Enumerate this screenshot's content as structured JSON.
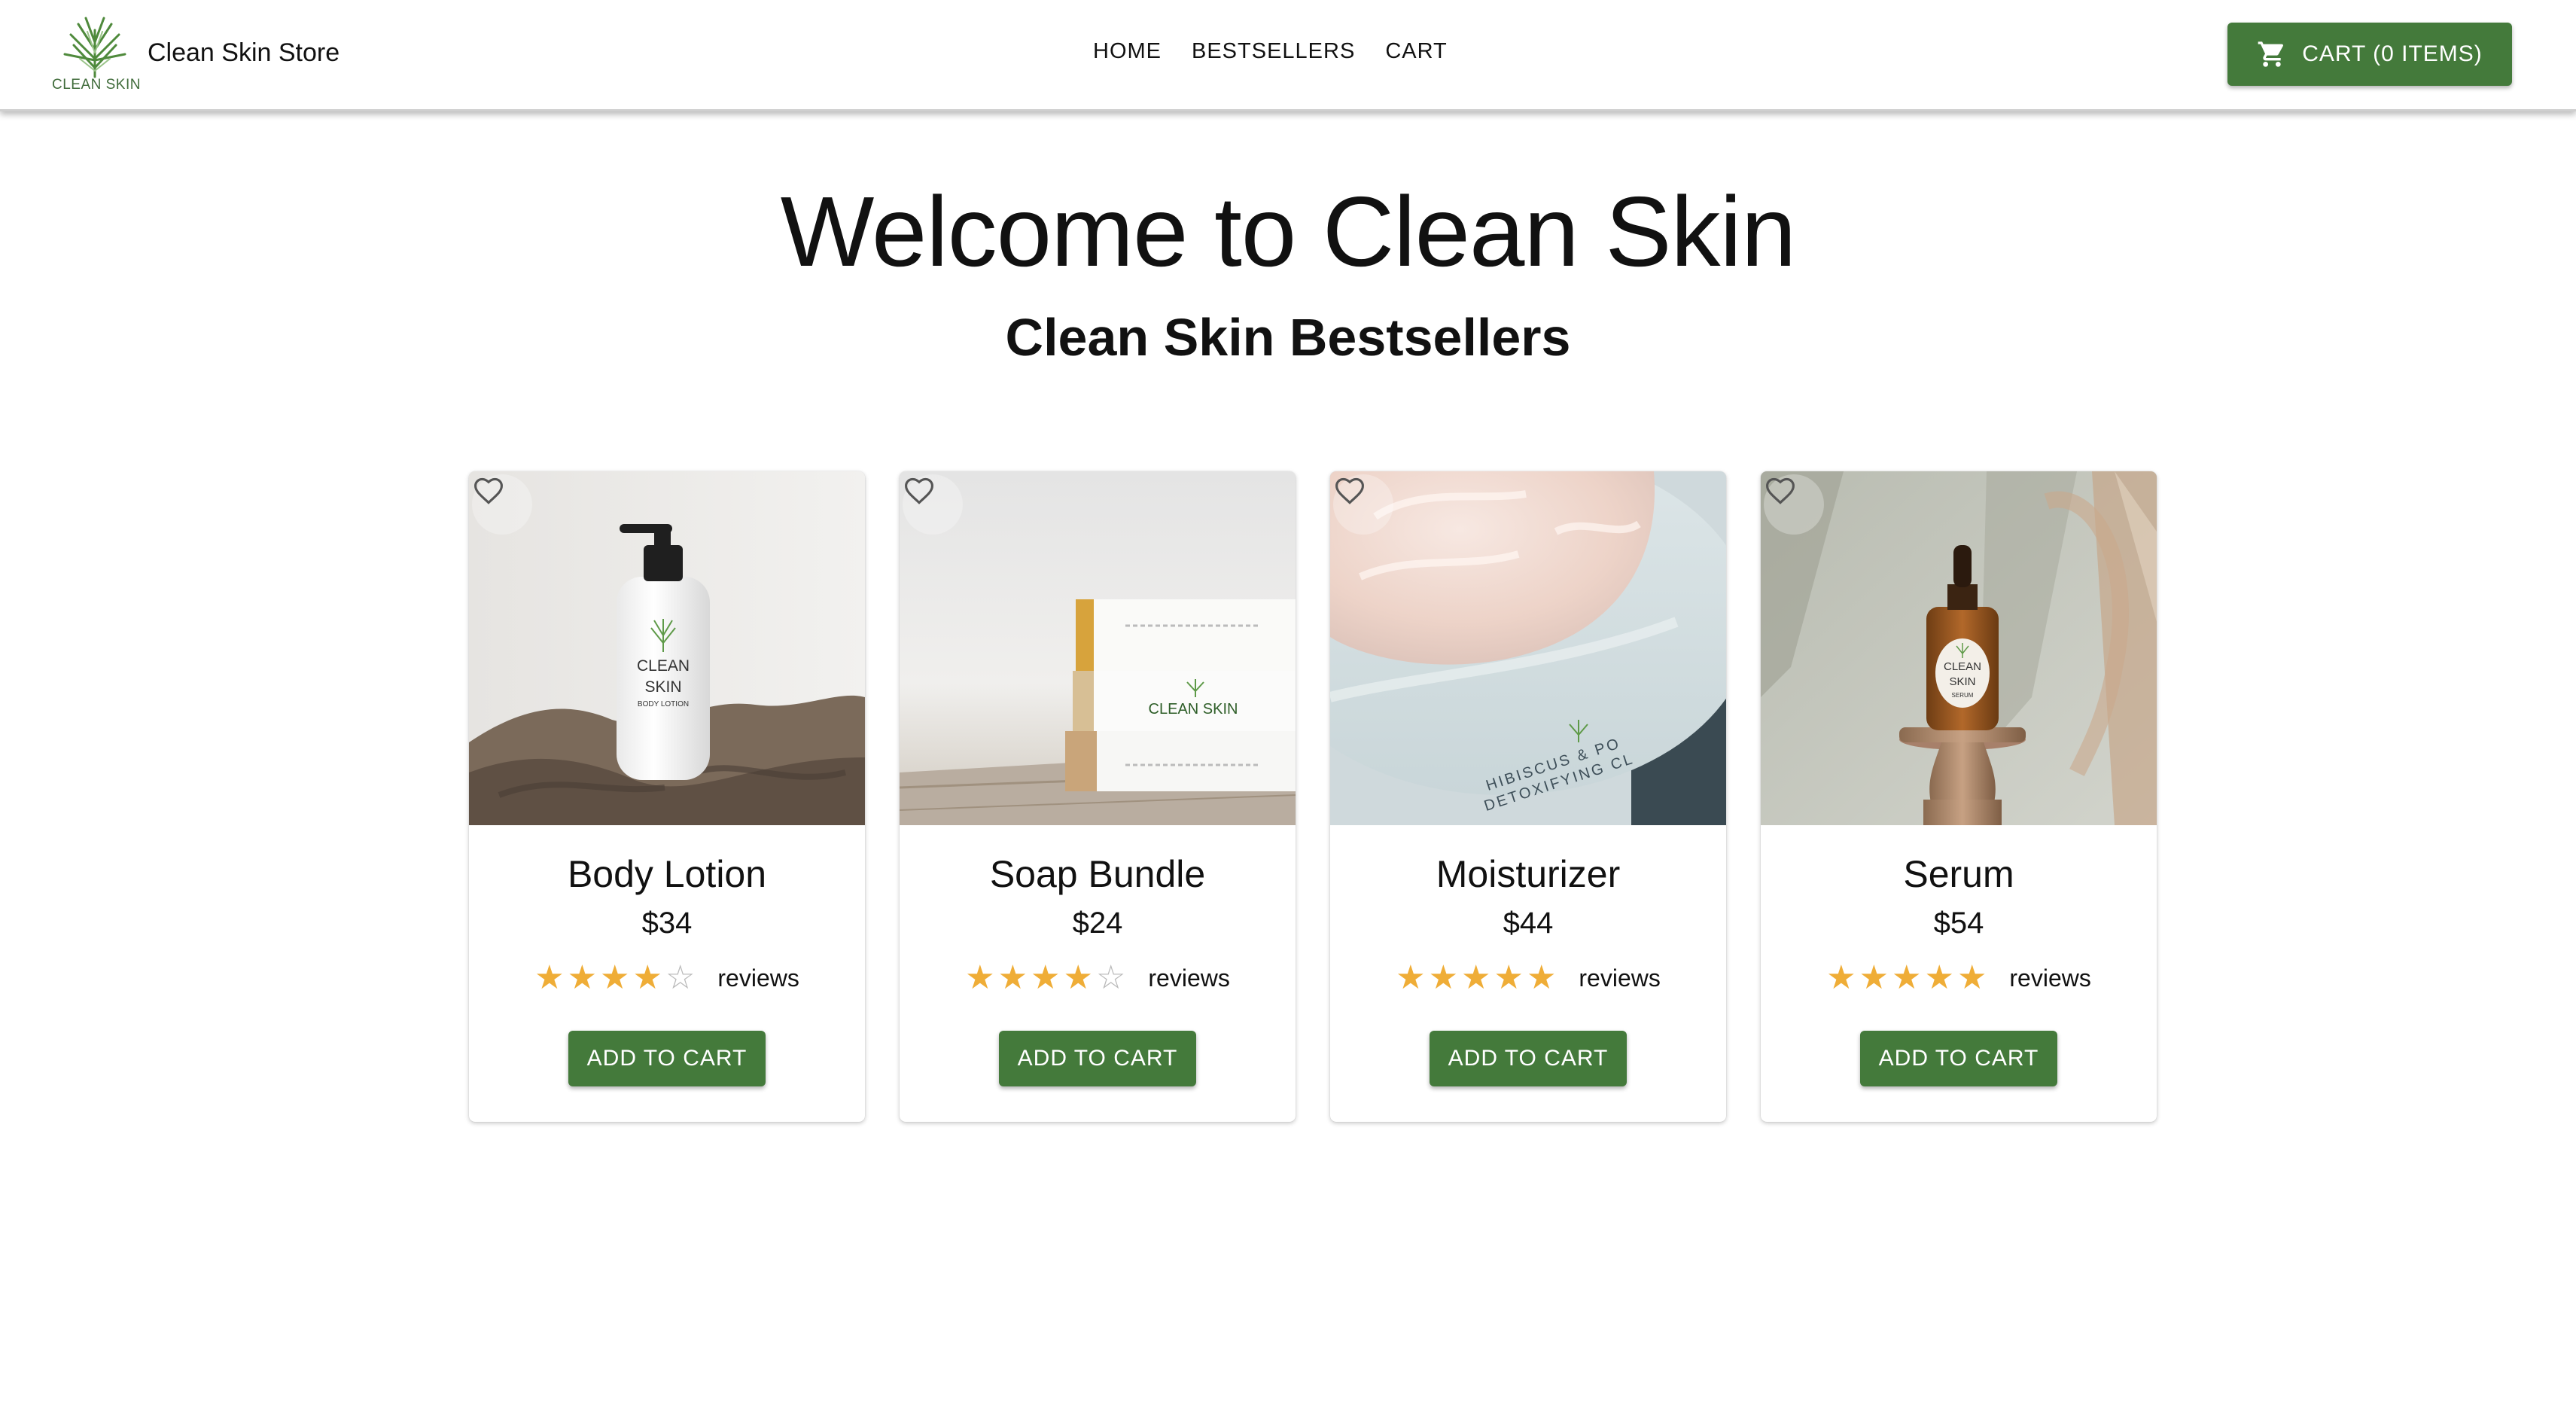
{
  "header": {
    "logo_text": "CLEAN SKIN",
    "store_name": "Clean Skin Store",
    "nav": [
      {
        "label": "HOME"
      },
      {
        "label": "BESTSELLERS"
      },
      {
        "label": "CART"
      }
    ],
    "cart_button": {
      "label": "CART (0 ITEMS)",
      "icon": "shopping-cart-icon"
    }
  },
  "hero": {
    "title": "Welcome to Clean Skin",
    "subtitle": "Clean Skin Bestsellers"
  },
  "colors": {
    "accent_green": "#447a3b",
    "star_gold": "#efad37",
    "star_empty": "#b9b9b9"
  },
  "products": [
    {
      "name": "Body Lotion",
      "price": "$34",
      "rating": 4,
      "reviews_label": "reviews",
      "button_label": "ADD TO CART",
      "image": {
        "label_line1": "CLEAN",
        "label_line2": "SKIN",
        "label_line3": "BODY LOTION"
      }
    },
    {
      "name": "Soap Bundle",
      "price": "$24",
      "rating": 4,
      "reviews_label": "reviews",
      "button_label": "ADD TO CART",
      "image": {
        "label_line1": "CLEAN SKIN"
      }
    },
    {
      "name": "Moisturizer",
      "price": "$44",
      "rating": 5,
      "reviews_label": "reviews",
      "button_label": "ADD TO CART",
      "image": {
        "label_line1": "HIBISCUS & PO",
        "label_line2": "DETOXIFYING CL"
      }
    },
    {
      "name": "Serum",
      "price": "$54",
      "rating": 5,
      "reviews_label": "reviews",
      "button_label": "ADD TO CART",
      "image": {
        "label_line1": "CLEAN",
        "label_line2": "SKIN",
        "label_line3": "SERUM"
      }
    }
  ]
}
